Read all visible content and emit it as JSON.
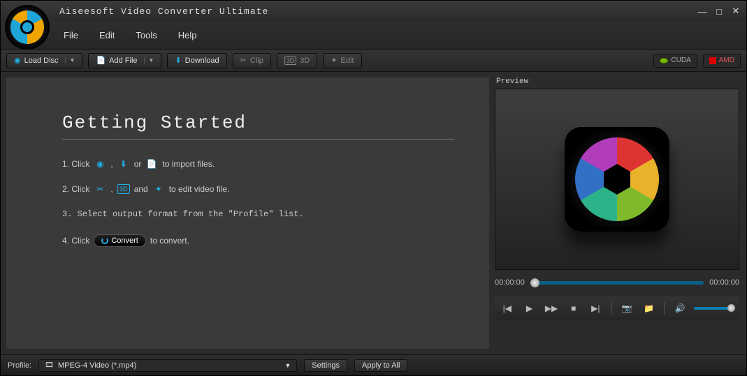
{
  "app": {
    "title": "Aiseesoft Video Converter Ultimate"
  },
  "menu": {
    "file": "File",
    "edit": "Edit",
    "tools": "Tools",
    "help": "Help"
  },
  "toolbar": {
    "load_disc": "Load Disc",
    "add_file": "Add File",
    "download": "Download",
    "clip": "Clip",
    "three_d": "3D",
    "edit": "Edit",
    "cuda": "CUDA",
    "amd": "AMD"
  },
  "preview": {
    "label": "Preview",
    "time_current": "00:00:00",
    "time_total": "00:00:00"
  },
  "getting_started": {
    "title": "Getting Started",
    "step1_a": "1. Click",
    "step1_b": ",",
    "step1_c": "or",
    "step1_d": "to import files.",
    "step2_a": "2. Click",
    "step2_b": ",",
    "step2_c": "and",
    "step2_d": "to edit video file.",
    "step3": "3. Select output format from the \"Profile\" list.",
    "step4_a": "4. Click",
    "step4_btn": "Convert",
    "step4_b": "to convert."
  },
  "bottom": {
    "profile_label": "Profile:",
    "profile_value": "MPEG-4 Video (*.mp4)",
    "settings": "Settings",
    "apply_all": "Apply to All"
  }
}
